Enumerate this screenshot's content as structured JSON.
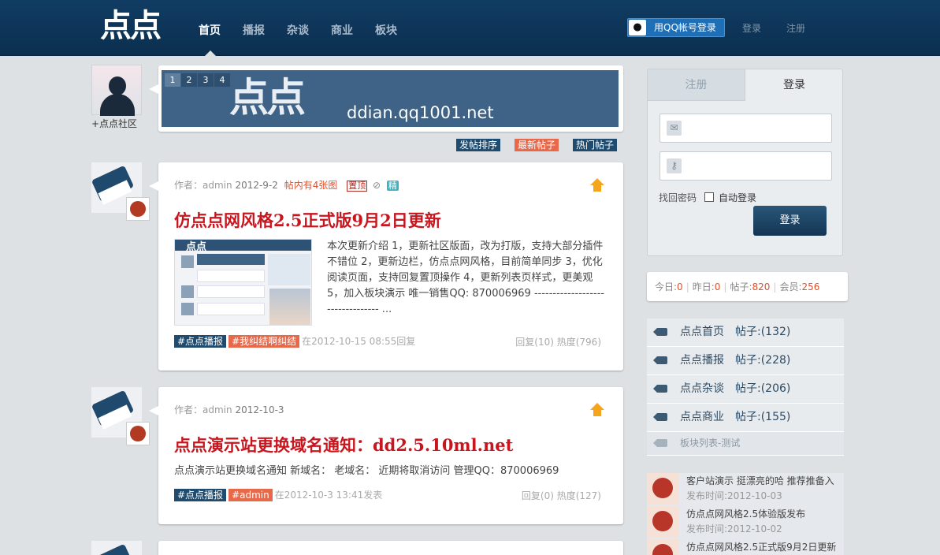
{
  "header": {
    "logo": "点点",
    "nav": [
      "首页",
      "播报",
      "杂谈",
      "商业",
      "板块"
    ],
    "qq_login": "用QQ帐号登录",
    "login": "登录",
    "register": "注册"
  },
  "profile": {
    "caption": "+点点社区"
  },
  "banner": {
    "slides": [
      "1",
      "2",
      "3",
      "4"
    ],
    "logo": "点点",
    "url": "ddian.qq1001.net"
  },
  "sort": [
    "发帖排序",
    "最新帖子",
    "热门帖子"
  ],
  "posts": [
    {
      "meta_author": "作者：admin",
      "date": "2012-9-2",
      "image_note": "帖内有4张图",
      "badge_top": "置顶",
      "badge_jing": "精",
      "title": "仿点点网风格2.5正式版9月2日更新",
      "excerpt": "本次更新介绍 1，更新社区版面，改为打版，支持大部分插件不错位 2，更新边栏，仿点点网风格，目前简单同步 3，优化阅读页面，支持回复置顶操作 4，更新列表页样式，更美观 5，加入板块演示 唯一销售QQ: 870006969 --------------------------------- ...",
      "tag1": "#点点播报",
      "tag2": "#我纠结啊纠结",
      "info": "在2012-10-15 08:55回复",
      "stats": "回复(10) 热度(796)"
    },
    {
      "meta_author": "作者：admin",
      "date": "2012-10-3",
      "title": "点点演示站更换域名通知：dd2.5.10ml.net",
      "excerpt": "点点演示站更换域名通知  新域名：  老域名：  近期将取消访问  管理QQ：870006969",
      "tag1": "#点点播报",
      "tag2": "#admin",
      "info": "在2012-10-3 13:41发表",
      "stats": "回复(0) 热度(127)"
    }
  ],
  "loginbox": {
    "tab_register": "注册",
    "tab_login": "登录",
    "email_placeholder": "",
    "password_placeholder": "",
    "find_password": "找回密码",
    "auto_login": "自动登录",
    "login_button": "登录"
  },
  "site_stats": {
    "today_label": "今日:",
    "today": "0",
    "yesterday_label": "昨日:",
    "yesterday": "0",
    "posts_label": "帖子:",
    "posts": "820",
    "members_label": "会员:",
    "members": "256"
  },
  "sections": [
    {
      "name": "点点首页",
      "count": "帖子:(132)"
    },
    {
      "name": "点点播报",
      "count": "帖子:(228)"
    },
    {
      "name": "点点杂谈",
      "count": "帖子:(206)"
    },
    {
      "name": "点点商业",
      "count": "帖子:(155)"
    }
  ],
  "section_test": "板块列表-测试",
  "recent": [
    {
      "title": "客户站演示  挺漂亮的哈  推荐推备入",
      "date": "发布时间:2012-10-03"
    },
    {
      "title": "仿点点网风格2.5体验版发布",
      "date": "发布时间:2012-10-02"
    },
    {
      "title": "仿点点网风格2.5正式版9月2日更新",
      "date": ""
    }
  ],
  "colors": {
    "header": "#0f3a60",
    "accent": "#c8161f",
    "tag_blue": "#1f4b6e",
    "tag_orange": "#e8684a"
  }
}
